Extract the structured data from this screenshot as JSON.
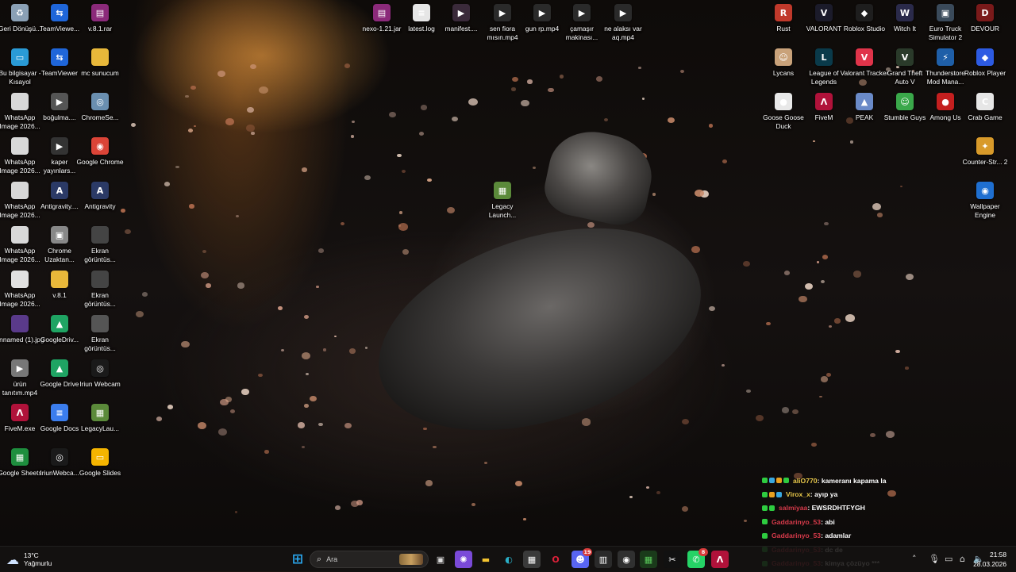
{
  "desktop": {
    "icons_left": [
      {
        "label": "Geri Dönüşü...",
        "icon": "recycle-bin-icon",
        "color": "#8aa0b5",
        "glyph": "♻"
      },
      {
        "label": "TeamViewe...",
        "icon": "teamviewer-icon",
        "color": "#1f66d9",
        "glyph": "⇆"
      },
      {
        "label": "v.8.1.rar",
        "icon": "winrar-icon",
        "color": "#8b2a7a",
        "glyph": "▤"
      },
      {
        "label": "Bu bilgisayar - Kısayol",
        "icon": "this-pc-icon",
        "color": "#2a9bd6",
        "glyph": "▭"
      },
      {
        "label": "TeamViewer",
        "icon": "teamviewer-icon",
        "color": "#1f66d9",
        "glyph": "⇆"
      },
      {
        "label": "mc sunucum",
        "icon": "folder-icon",
        "color": "#e8b83a",
        "glyph": ""
      },
      {
        "label": "WhatsApp Image 2026...",
        "icon": "image-file-icon",
        "color": "#d8d8d8",
        "glyph": ""
      },
      {
        "label": "boğulma....",
        "icon": "video-file-icon",
        "color": "#555555",
        "glyph": "▶"
      },
      {
        "label": "ChromeSe...",
        "icon": "chrome-setup-icon",
        "color": "#6a8fb0",
        "glyph": "◎"
      },
      {
        "label": "WhatsApp Image 2026...",
        "icon": "image-file-icon",
        "color": "#d8d8d8",
        "glyph": ""
      },
      {
        "label": "kaper yayınlars...",
        "icon": "video-file-icon",
        "color": "#333333",
        "glyph": "▶"
      },
      {
        "label": "Google Chrome",
        "icon": "chrome-icon",
        "color": "#db4437",
        "glyph": "◉"
      },
      {
        "label": "WhatsApp Image 2026...",
        "icon": "image-file-icon",
        "color": "#d8d8d8",
        "glyph": ""
      },
      {
        "label": "Antigravity....",
        "icon": "antigravity-icon",
        "color": "#2b3a66",
        "glyph": "A"
      },
      {
        "label": "Antigravity",
        "icon": "antigravity-icon",
        "color": "#2b3a66",
        "glyph": "A"
      },
      {
        "label": "WhatsApp Image 2026...",
        "icon": "image-file-icon",
        "color": "#d8d8d8",
        "glyph": ""
      },
      {
        "label": "Chrome Uzaktan...",
        "icon": "chrome-remote-icon",
        "color": "#888888",
        "glyph": "▣"
      },
      {
        "label": "Ekran görüntüs...",
        "icon": "screenshot-file-icon",
        "color": "#444444",
        "glyph": ""
      },
      {
        "label": "WhatsApp Image 2026...",
        "icon": "image-file-icon",
        "color": "#e0e0e0",
        "glyph": ""
      },
      {
        "label": "v.8.1",
        "icon": "folder-icon",
        "color": "#e8b83a",
        "glyph": ""
      },
      {
        "label": "Ekran görüntüs...",
        "icon": "screenshot-file-icon",
        "color": "#444444",
        "glyph": ""
      },
      {
        "label": "unnamed (1).jpg",
        "icon": "image-file-icon",
        "color": "#5a3a8a",
        "glyph": ""
      },
      {
        "label": "GoogleDriv...",
        "icon": "google-drive-icon",
        "color": "#1fa463",
        "glyph": "▲"
      },
      {
        "label": "Ekran görüntüs...",
        "icon": "screenshot-file-icon",
        "color": "#555555",
        "glyph": ""
      },
      {
        "label": "ürün tanıtım.mp4",
        "icon": "video-file-icon",
        "color": "#777777",
        "glyph": "▶"
      },
      {
        "label": "Google Drive",
        "icon": "google-drive-icon",
        "color": "#1fa463",
        "glyph": "▲"
      },
      {
        "label": "Iriun Webcam",
        "icon": "iriun-webcam-icon",
        "color": "#1a1a1a",
        "glyph": "◎"
      },
      {
        "label": "FiveM.exe",
        "icon": "fivem-icon",
        "color": "#b0123a",
        "glyph": "Λ"
      },
      {
        "label": "Google Docs",
        "icon": "google-docs-icon",
        "color": "#3b7ded",
        "glyph": "≡"
      },
      {
        "label": "LegacyLau...",
        "icon": "minecraft-icon",
        "color": "#5b8a3a",
        "glyph": "▦"
      },
      {
        "label": "Google Sheets",
        "icon": "google-sheets-icon",
        "color": "#1e8e3e",
        "glyph": "▦"
      },
      {
        "label": "IriunWebca...",
        "icon": "iriun-webcam-icon",
        "color": "#1a1a1a",
        "glyph": "◎"
      },
      {
        "label": "Google Slides",
        "icon": "google-slides-icon",
        "color": "#f4b400",
        "glyph": "▭"
      }
    ],
    "icons_top": [
      {
        "label": "nexo-1.21.jar",
        "icon": "java-archive-icon",
        "color": "#8b2a7a",
        "glyph": "▤"
      },
      {
        "label": "latest.log",
        "icon": "text-file-icon",
        "color": "#e6e6e6",
        "glyph": "≡"
      },
      {
        "label": "manifest....",
        "icon": "video-file-icon",
        "color": "#3a2a3a",
        "glyph": "▶"
      },
      {
        "label": "sen fiora mısın.mp4",
        "icon": "video-file-icon",
        "color": "#2a2a2a",
        "glyph": "▶"
      },
      {
        "label": "gun rp.mp4",
        "icon": "video-file-icon",
        "color": "#2a2a2a",
        "glyph": "▶"
      },
      {
        "label": "çamaşır makinası...",
        "icon": "video-file-icon",
        "color": "#2a2a2a",
        "glyph": "▶"
      },
      {
        "label": "ne alaksı var aq.mp4",
        "icon": "video-file-icon",
        "color": "#2a2a2a",
        "glyph": "▶"
      }
    ],
    "icon_middle": {
      "label": "Legacy Launch...",
      "icon": "legacy-launcher-icon",
      "color": "#5b8a3a",
      "glyph": "▦"
    },
    "icons_right": [
      {
        "label": "Rust",
        "icon": "rust-icon",
        "color": "#c0392b",
        "glyph": "R"
      },
      {
        "label": "VALORANT",
        "icon": "valorant-icon",
        "color": "#1b1b2a",
        "glyph": "V"
      },
      {
        "label": "Roblox Studio",
        "icon": "roblox-studio-icon",
        "color": "#1e1e1e",
        "glyph": "◆"
      },
      {
        "label": "Witch It",
        "icon": "witch-it-icon",
        "color": "#2a2a4a",
        "glyph": "W"
      },
      {
        "label": "Euro Truck Simulator 2",
        "icon": "euro-truck-icon",
        "color": "#3a4a5a",
        "glyph": "▣"
      },
      {
        "label": "DEVOUR",
        "icon": "devour-icon",
        "color": "#7a1a1a",
        "glyph": "D"
      },
      {
        "label": "Lycans",
        "icon": "lycans-icon",
        "color": "#c9a27a",
        "glyph": "☺"
      },
      {
        "label": "League of Legends",
        "icon": "league-of-legends-icon",
        "color": "#0a3a4a",
        "glyph": "L"
      },
      {
        "label": "Valorant Tracker",
        "icon": "valorant-tracker-icon",
        "color": "#e0344a",
        "glyph": "V"
      },
      {
        "label": "Grand Theft Auto V",
        "icon": "gta-v-icon",
        "color": "#2a3a2a",
        "glyph": "V"
      },
      {
        "label": "Thunderstore Mod Mana...",
        "icon": "thunderstore-icon",
        "color": "#1f5fa8",
        "glyph": "⚡"
      },
      {
        "label": "Roblox Player",
        "icon": "roblox-player-icon",
        "color": "#2d5be3",
        "glyph": "◆"
      },
      {
        "label": "Goose Goose Duck",
        "icon": "goose-goose-duck-icon",
        "color": "#e8e8e8",
        "glyph": "●"
      },
      {
        "label": "FiveM",
        "icon": "fivem-icon",
        "color": "#b0123a",
        "glyph": "Λ"
      },
      {
        "label": "PEAK",
        "icon": "peak-icon",
        "color": "#6a8ac8",
        "glyph": "▲"
      },
      {
        "label": "Stumble Guys",
        "icon": "stumble-guys-icon",
        "color": "#3aa84a",
        "glyph": "☺"
      },
      {
        "label": "Among Us",
        "icon": "among-us-icon",
        "color": "#c41f1f",
        "glyph": "●"
      },
      {
        "label": "Crab Game",
        "icon": "crab-game-icon",
        "color": "#e6e6e6",
        "glyph": "C"
      },
      {
        "label": "Counter-Str... 2",
        "icon": "counter-strike-icon",
        "color": "#d89a2a",
        "glyph": "✦"
      },
      {
        "label": "Wallpaper Engine",
        "icon": "wallpaper-engine-icon",
        "color": "#1f6fd0",
        "glyph": "◉"
      }
    ]
  },
  "chat": [
    {
      "user": "aliO770",
      "user_color": "#e8c84a",
      "message": " : kameranı kapama la",
      "badges": [
        "#2ecc40",
        "#3aa8e0",
        "#e8a020",
        "#2ecc40"
      ]
    },
    {
      "user": "Virox_x",
      "user_color": "#e8c84a",
      "message": " : ayıp ya",
      "badges": [
        "#2ecc40",
        "#e8a020",
        "#3aa8e0"
      ]
    },
    {
      "user": "salmiyaa",
      "user_color": "#d63a4a",
      "message": " : EWSRDHTFYGH",
      "badges": [
        "#2ecc40",
        "#2ecc40"
      ]
    },
    {
      "user": "Gaddarinyo_53",
      "user_color": "#d63a4a",
      "message": " : abi",
      "badges": [
        "#2ecc40"
      ]
    },
    {
      "user": "Gaddarinyo_53",
      "user_color": "#d63a4a",
      "message": " : adamlar",
      "badges": [
        "#2ecc40"
      ]
    },
    {
      "user": "Gaddarinyo_53",
      "user_color": "#d63a4a",
      "message": " : dc de",
      "badges": [
        "#2ecc40"
      ]
    },
    {
      "user": "Gaddarinyo_53",
      "user_color": "#d63a4a",
      "message": " : kimya çözüyo ***",
      "badges": [
        "#2ecc40"
      ]
    }
  ],
  "taskbar": {
    "weather": {
      "temp": "13°C",
      "condition": "Yağmurlu",
      "icon": "cloud-rain-icon"
    },
    "search_placeholder": "Ara",
    "apps": [
      {
        "name": "start-button-icon",
        "glyph": "⊞",
        "color": "#2aa8f0",
        "bg": "transparent"
      },
      {
        "name": "task-view-icon",
        "glyph": "▣",
        "color": "#dddddd",
        "bg": "transparent"
      },
      {
        "name": "copilot-icon",
        "glyph": "✺",
        "color": "#ffffff",
        "bg": "#7a4ad8"
      },
      {
        "name": "file-explorer-icon",
        "glyph": "▬",
        "color": "#f4c430",
        "bg": "transparent"
      },
      {
        "name": "edge-icon",
        "glyph": "◐",
        "color": "#2ab0c8",
        "bg": "transparent"
      },
      {
        "name": "microsoft-store-icon",
        "glyph": "▦",
        "color": "#ffffff",
        "bg": "#3a3a3a"
      },
      {
        "name": "opera-icon",
        "glyph": "O",
        "color": "#e0213a",
        "bg": "transparent"
      },
      {
        "name": "discord-icon",
        "glyph": "☻",
        "color": "#ffffff",
        "bg": "#5865f2",
        "badge": "19"
      },
      {
        "name": "game-app-icon",
        "glyph": "▥",
        "color": "#ffffff",
        "bg": "#2a2a2a"
      },
      {
        "name": "obs-icon",
        "glyph": "◉",
        "color": "#ffffff",
        "bg": "#303030"
      },
      {
        "name": "minecraft-launcher-icon",
        "glyph": "▦",
        "color": "#5ac85a",
        "bg": "#1a3a1a"
      },
      {
        "name": "capcut-icon",
        "glyph": "✂",
        "color": "#ffffff",
        "bg": "#111111"
      },
      {
        "name": "whatsapp-icon",
        "glyph": "✆",
        "color": "#ffffff",
        "bg": "#25d366",
        "badge": "8"
      },
      {
        "name": "fivem-taskbar-icon",
        "glyph": "Λ",
        "color": "#ffffff",
        "bg": "#b0123a"
      }
    ],
    "clock": {
      "time": "21:58",
      "date": "28.03.2026"
    }
  }
}
